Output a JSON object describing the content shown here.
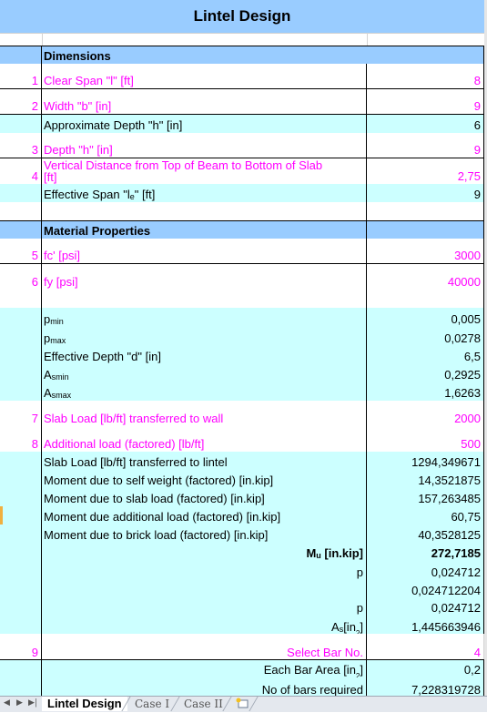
{
  "title": "Lintel Design",
  "sections": {
    "dimensions": "Dimensions",
    "material": "Material Properties"
  },
  "rows": {
    "clear_span": {
      "num": "1",
      "label": "Clear Span \"l\" [ft]",
      "value": "8"
    },
    "width": {
      "num": "2",
      "label": "Width \"b\" [in]",
      "value": "9"
    },
    "approx_depth": {
      "label": "Approximate Depth \"h\" [in]",
      "value": "6"
    },
    "depth": {
      "num": "3",
      "label": "Depth \"h\" [in]",
      "value": "9"
    },
    "vertical_distance": {
      "num": "4",
      "label_line1": "Vertical Distance from Top of Beam to Bottom of Slab",
      "label_line2": "[ft]",
      "value": "2,75"
    },
    "effective_span": {
      "label_pre": "Effective Span \"l",
      "label_sub": "e",
      "label_post": "\" [ft]",
      "value": "9"
    },
    "fc": {
      "num": "5",
      "label": "fc' [psi]",
      "value": "3000"
    },
    "fy": {
      "num": "6",
      "label": "fy [psi]",
      "value": "40000"
    },
    "pmin": {
      "label": "p",
      "sub": "min",
      "value": "0,005"
    },
    "pmax": {
      "label": "p",
      "sub": "max",
      "value": "0,0278"
    },
    "eff_depth": {
      "label": "Effective Depth \"d\" [in]",
      "value": "6,5"
    },
    "asmin": {
      "label": "A",
      "sub": "smin",
      "value": "0,2925"
    },
    "asmax": {
      "label": "A",
      "sub": "smax",
      "value": "1,6263"
    },
    "slab_load_wall": {
      "num": "7",
      "label": "Slab Load [lb/ft] transferred to wall",
      "value": "2000"
    },
    "additional_load": {
      "num": "8",
      "label": "Additional load (factored) [lb/ft]",
      "value": "500"
    },
    "slab_load_lintel": {
      "label": "Slab Load [lb/ft] transferred to lintel",
      "value": "1294,349671"
    },
    "moment_self": {
      "label": "Moment due to self weight (factored) [in.kip]",
      "value": "14,3521875"
    },
    "moment_slab": {
      "label": "Moment due to slab load (factored) [in.kip]",
      "value": "157,263485"
    },
    "moment_additional": {
      "label": "Moment due additional load (factored) [in.kip]",
      "value": "60,75"
    },
    "moment_brick": {
      "label": "Moment due to brick load (factored) [in.kip]",
      "value": "40,3528125"
    },
    "mu": {
      "label": "M",
      "sub": "u",
      "label_post": " [in.kip]",
      "value": "272,7185"
    },
    "p1": {
      "label": "p",
      "value": "0,024712"
    },
    "p_raw": {
      "value": "0,024712204"
    },
    "p2": {
      "label": "p",
      "value": "0,024712"
    },
    "as": {
      "label": "A",
      "sub": "s",
      "label_mid": "[in",
      "sup": "2",
      "label_post": "]",
      "value": "1,445663946"
    },
    "bar_no": {
      "num": "9",
      "label": "Select Bar No.",
      "value": "4"
    },
    "bar_area": {
      "label": "Each Bar Area [in",
      "sup": "2",
      "label_post": "]",
      "value": "0,2"
    },
    "bars_required": {
      "label": "No of bars required",
      "value": "7,228319728"
    }
  },
  "tabs": {
    "sheets": [
      "Lintel Design",
      "Case I",
      "Case II"
    ],
    "active": "Lintel Design"
  }
}
